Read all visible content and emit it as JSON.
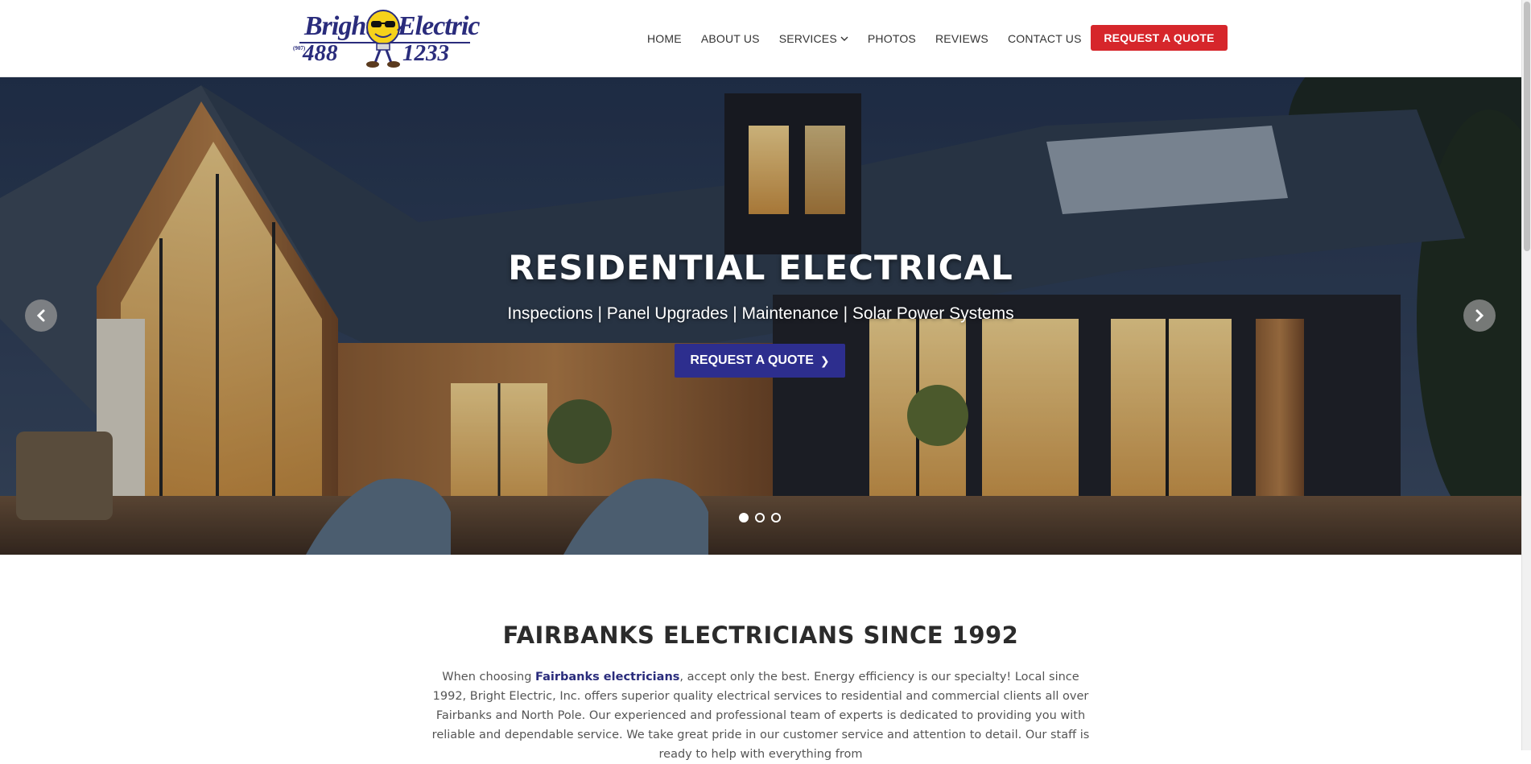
{
  "logo": {
    "word1": "Bright",
    "word2": "Electric",
    "area_code": "(907)",
    "num1": "488",
    "num2": "1233"
  },
  "nav": {
    "items": [
      "HOME",
      "ABOUT US",
      "SERVICES",
      "PHOTOS",
      "REVIEWS",
      "CONTACT US"
    ],
    "cta": "REQUEST A QUOTE"
  },
  "hero": {
    "title": "RESIDENTIAL ELECTRICAL",
    "subtitle": "Inspections | Panel Upgrades | Maintenance | Solar Power Systems",
    "button": "REQUEST A QUOTE",
    "slide_count": 3,
    "active_slide": 1
  },
  "about": {
    "title": "FAIRBANKS ELECTRICIANS SINCE 1992",
    "text_before": "When choosing ",
    "link": "Fairbanks electricians",
    "text_after": ", accept only the best. Energy efficiency is our specialty! Local since 1992, Bright Electric, Inc. offers superior quality electrical services to residential and commercial clients all over Fairbanks and North Pole. Our experienced and professional team of experts is dedicated to providing you with reliable and dependable service. We take great pride in our customer service and attention to detail. Our staff is ready to help with everything from"
  },
  "colors": {
    "brand_blue": "#2a2c7c",
    "cta_red": "#d6262b",
    "hero_button": "#2d2e8e"
  },
  "icons": {
    "prev": "chevron-left-icon",
    "next": "chevron-right-icon",
    "dropdown": "chevron-down-icon"
  }
}
